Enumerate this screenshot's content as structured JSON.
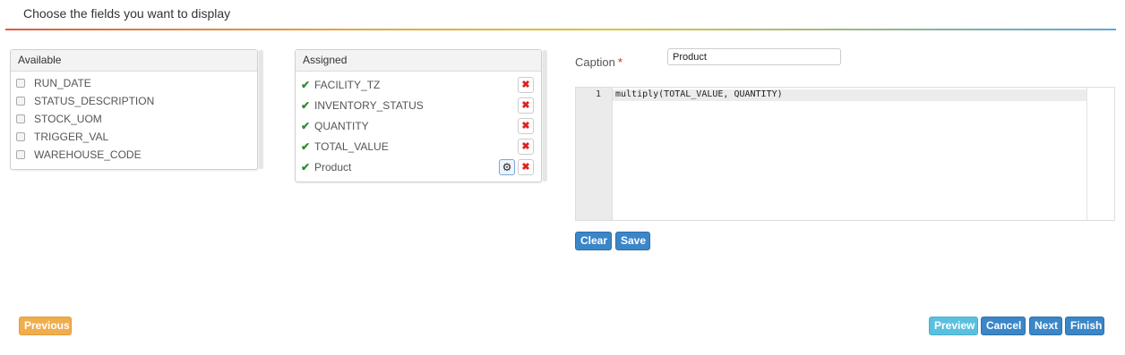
{
  "header": {
    "title": "Choose the fields you want to display"
  },
  "available": {
    "title": "Available",
    "items": [
      "RUN_DATE",
      "STATUS_DESCRIPTION",
      "STOCK_UOM",
      "TRIGGER_VAL",
      "WAREHOUSE_CODE"
    ]
  },
  "assigned": {
    "title": "Assigned",
    "items": [
      "FACILITY_TZ",
      "INVENTORY_STATUS",
      "QUANTITY",
      "TOTAL_VALUE",
      "Product"
    ],
    "check_glyph": "✔",
    "remove_glyph": "✖",
    "gear_glyph": "⚙"
  },
  "editor": {
    "caption_label": "Caption",
    "required_mark": "*",
    "caption_value": "Product",
    "line_number": "1",
    "code": "multiply(TOTAL_VALUE, QUANTITY)",
    "clear_label": "Clear",
    "save_label": "Save"
  },
  "footer": {
    "previous_label": "Previous",
    "preview_label": "Preview",
    "cancel_label": "Cancel",
    "next_label": "Next",
    "finish_label": "Finish"
  }
}
